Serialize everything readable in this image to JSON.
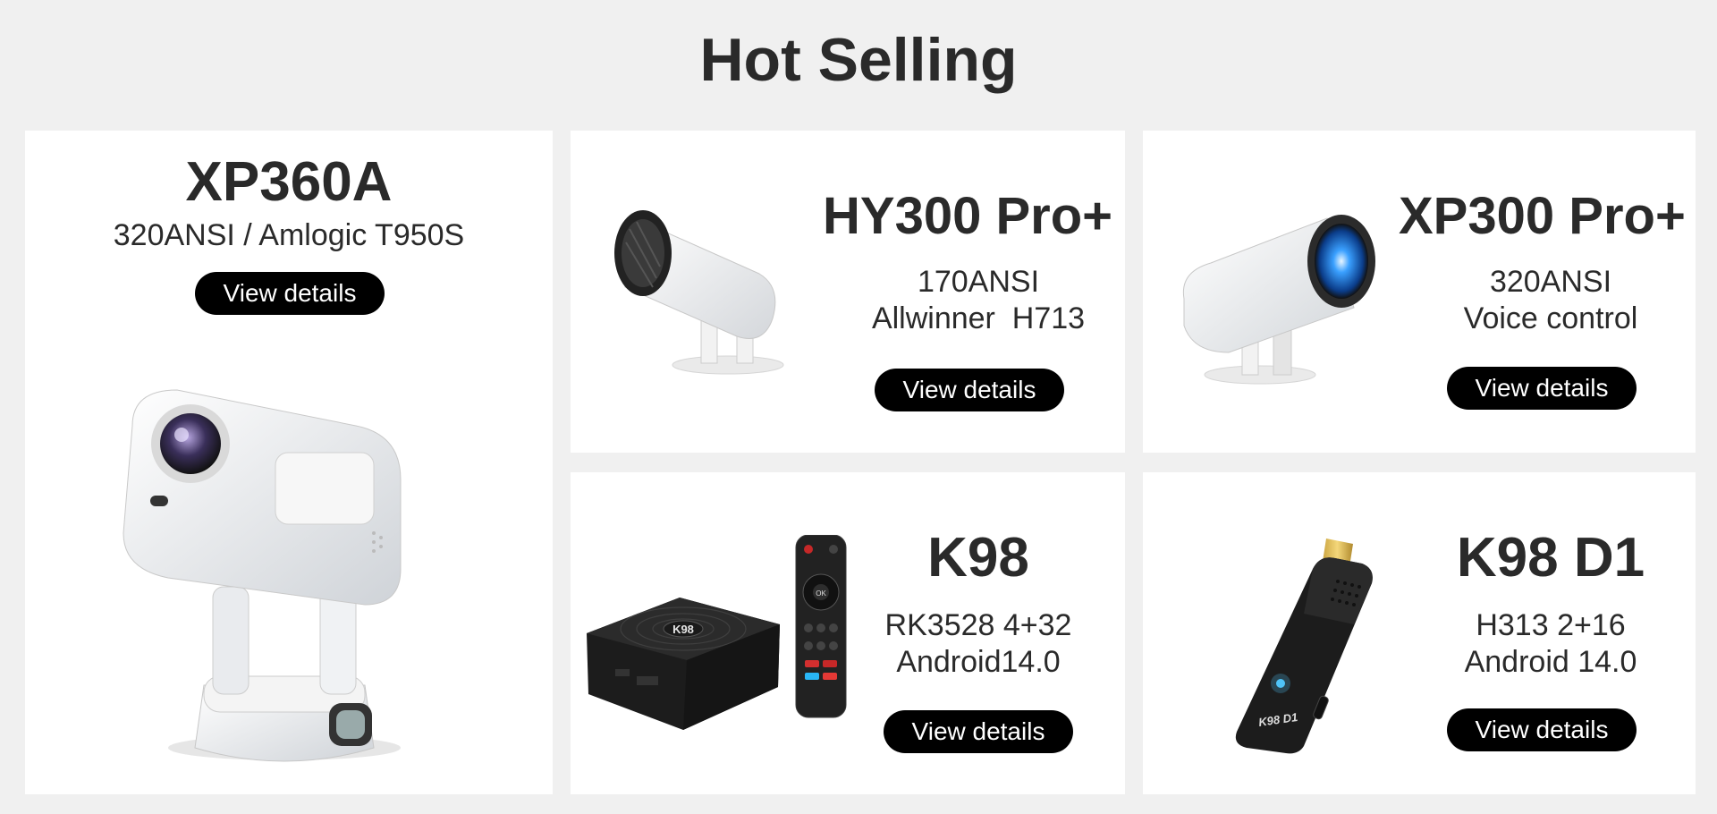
{
  "section": {
    "title": "Hot Selling"
  },
  "products": [
    {
      "name": "XP360A",
      "specs": [
        "320ANSI / Amlogic T950S"
      ],
      "button": "View details",
      "image_icon": "projector-image"
    },
    {
      "name": "HY300 Pro+",
      "specs": [
        "170ANSI",
        "Allwinner  H713"
      ],
      "button": "View details",
      "image_icon": "projector-image"
    },
    {
      "name": "XP300 Pro+",
      "specs": [
        "320ANSI",
        "Voice control"
      ],
      "button": "View details",
      "image_icon": "projector-image"
    },
    {
      "name": "K98",
      "specs": [
        "RK3528 4+32",
        "Android14.0"
      ],
      "button": "View details",
      "image_icon": "tv-box-remote-image",
      "box_label": "K98"
    },
    {
      "name": "K98 D1",
      "specs": [
        "H313 2+16",
        "Android 14.0"
      ],
      "button": "View details",
      "image_icon": "tv-stick-image",
      "stick_label": "K98 D1"
    }
  ]
}
